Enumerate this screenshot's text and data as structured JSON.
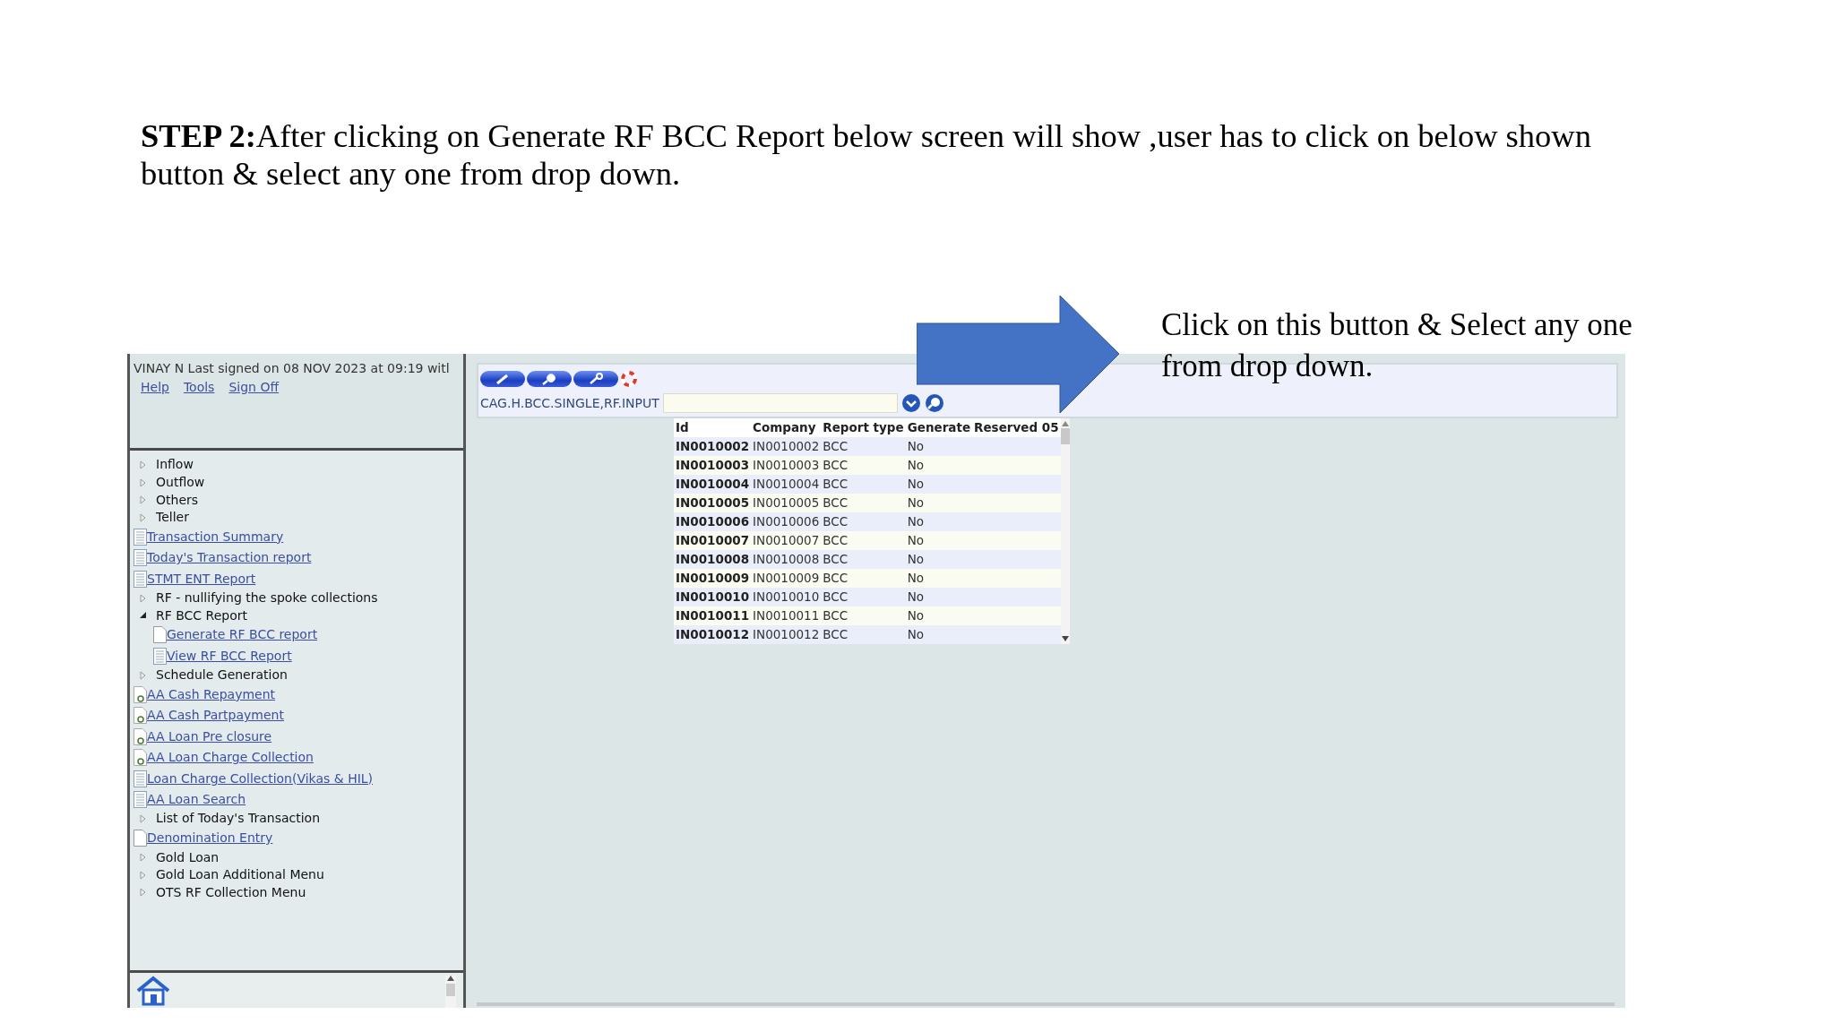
{
  "instruction": "**STEP 2:**After clicking on Generate RF BCC Report below screen will show ,user has to click on below shown button & select any one from drop down.",
  "callout": "Click on this button & Select any one from drop down.",
  "app": {
    "signed_in": "VINAY N Last signed on 08 NOV 2023 at 09:19 witl",
    "links": [
      "Help",
      "Tools",
      "Sign Off"
    ],
    "menu": [
      {
        "kind": "folder",
        "label": "Inflow",
        "expanded": false
      },
      {
        "kind": "folder",
        "label": "Outflow",
        "expanded": false
      },
      {
        "kind": "folder",
        "label": "Others",
        "expanded": false
      },
      {
        "kind": "folder",
        "label": "Teller",
        "expanded": false
      },
      {
        "kind": "report",
        "label": "Transaction Summary"
      },
      {
        "kind": "report",
        "label": "Today's Transaction report"
      },
      {
        "kind": "report",
        "label": "STMT ENT Report"
      },
      {
        "kind": "folder",
        "label": "RF - nullifying the spoke collections",
        "expanded": false
      },
      {
        "kind": "folder",
        "label": "RF BCC Report",
        "expanded": true,
        "children": [
          {
            "kind": "page",
            "label": "Generate RF BCC report"
          },
          {
            "kind": "report",
            "label": "View RF BCC Report"
          }
        ]
      },
      {
        "kind": "folder",
        "label": "Schedule Generation",
        "expanded": false
      },
      {
        "kind": "app",
        "label": "AA Cash Repayment"
      },
      {
        "kind": "app",
        "label": "AA Cash Partpayment"
      },
      {
        "kind": "app",
        "label": "AA Loan Pre closure"
      },
      {
        "kind": "app",
        "label": "AA Loan Charge Collection"
      },
      {
        "kind": "report",
        "label": "Loan Charge Collection(Vikas & HIL)"
      },
      {
        "kind": "report",
        "label": "AA Loan Search"
      },
      {
        "kind": "folder",
        "label": "List of Today's Transaction",
        "expanded": false
      },
      {
        "kind": "page",
        "label": "Denomination Entry"
      },
      {
        "kind": "folder",
        "label": "Gold Loan",
        "expanded": false
      },
      {
        "kind": "folder",
        "label": "Gold Loan Additional Menu",
        "expanded": false
      },
      {
        "kind": "folder",
        "label": "OTS RF Collection Menu",
        "expanded": false
      }
    ],
    "version": "CAG.H.BCC.SINGLE,RF.INPUT",
    "table": {
      "columns": [
        "Id",
        "Company",
        "Report type",
        "Generate",
        "Reserved 05"
      ],
      "rows": [
        [
          "IN0010002",
          "IN0010002",
          "BCC",
          "No"
        ],
        [
          "IN0010003",
          "IN0010003",
          "BCC",
          "No"
        ],
        [
          "IN0010004",
          "IN0010004",
          "BCC",
          "No"
        ],
        [
          "IN0010005",
          "IN0010005",
          "BCC",
          "No"
        ],
        [
          "IN0010006",
          "IN0010006",
          "BCC",
          "No"
        ],
        [
          "IN0010007",
          "IN0010007",
          "BCC",
          "No"
        ],
        [
          "IN0010008",
          "IN0010008",
          "BCC",
          "No"
        ],
        [
          "IN0010009",
          "IN0010009",
          "BCC",
          "No"
        ],
        [
          "IN0010010",
          "IN0010010",
          "BCC",
          "No"
        ],
        [
          "IN0010011",
          "IN0010011",
          "BCC",
          "No"
        ],
        [
          "IN0010012",
          "IN0010012",
          "BCC",
          "No"
        ]
      ]
    }
  }
}
